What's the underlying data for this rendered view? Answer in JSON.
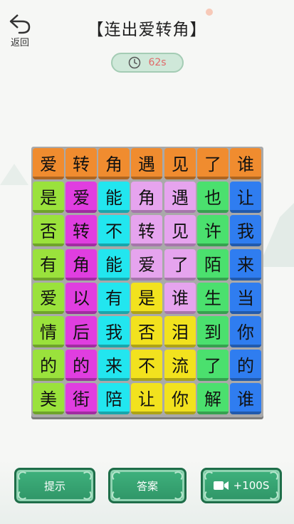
{
  "header": {
    "back_label": "返回",
    "title": "【连出爱转角】",
    "timer": "62s"
  },
  "colors": {
    "orange": "#f08c2f",
    "green": "#9ae23c",
    "magenta": "#e03ee0",
    "cyan": "#22e6ef",
    "lilac": "#e6a4ee",
    "blue": "#2f7df0",
    "yellow": "#f2e21e",
    "mint": "#4be06e"
  },
  "board": {
    "rows": [
      [
        {
          "ch": "爱",
          "c": "orange"
        },
        {
          "ch": "转",
          "c": "orange"
        },
        {
          "ch": "角",
          "c": "orange"
        },
        {
          "ch": "遇",
          "c": "orange"
        },
        {
          "ch": "见",
          "c": "orange"
        },
        {
          "ch": "了",
          "c": "orange"
        },
        {
          "ch": "谁",
          "c": "orange"
        }
      ],
      [
        {
          "ch": "是",
          "c": "green"
        },
        {
          "ch": "爱",
          "c": "magenta"
        },
        {
          "ch": "能",
          "c": "cyan"
        },
        {
          "ch": "角",
          "c": "lilac"
        },
        {
          "ch": "遇",
          "c": "lilac"
        },
        {
          "ch": "也",
          "c": "mint"
        },
        {
          "ch": "让",
          "c": "blue"
        }
      ],
      [
        {
          "ch": "否",
          "c": "green"
        },
        {
          "ch": "转",
          "c": "magenta"
        },
        {
          "ch": "不",
          "c": "cyan"
        },
        {
          "ch": "转",
          "c": "lilac"
        },
        {
          "ch": "见",
          "c": "lilac"
        },
        {
          "ch": "许",
          "c": "mint"
        },
        {
          "ch": "我",
          "c": "blue"
        }
      ],
      [
        {
          "ch": "有",
          "c": "green"
        },
        {
          "ch": "角",
          "c": "magenta"
        },
        {
          "ch": "能",
          "c": "cyan"
        },
        {
          "ch": "爱",
          "c": "lilac"
        },
        {
          "ch": "了",
          "c": "lilac"
        },
        {
          "ch": "陌",
          "c": "mint"
        },
        {
          "ch": "来",
          "c": "blue"
        }
      ],
      [
        {
          "ch": "爱",
          "c": "green"
        },
        {
          "ch": "以",
          "c": "magenta"
        },
        {
          "ch": "有",
          "c": "cyan"
        },
        {
          "ch": "是",
          "c": "yellow"
        },
        {
          "ch": "谁",
          "c": "lilac"
        },
        {
          "ch": "生",
          "c": "mint"
        },
        {
          "ch": "当",
          "c": "blue"
        }
      ],
      [
        {
          "ch": "情",
          "c": "green"
        },
        {
          "ch": "后",
          "c": "magenta"
        },
        {
          "ch": "我",
          "c": "cyan"
        },
        {
          "ch": "否",
          "c": "yellow"
        },
        {
          "ch": "泪",
          "c": "yellow"
        },
        {
          "ch": "到",
          "c": "mint"
        },
        {
          "ch": "你",
          "c": "blue"
        }
      ],
      [
        {
          "ch": "的",
          "c": "green"
        },
        {
          "ch": "的",
          "c": "magenta"
        },
        {
          "ch": "来",
          "c": "cyan"
        },
        {
          "ch": "不",
          "c": "yellow"
        },
        {
          "ch": "流",
          "c": "yellow"
        },
        {
          "ch": "了",
          "c": "mint"
        },
        {
          "ch": "的",
          "c": "blue"
        }
      ],
      [
        {
          "ch": "美",
          "c": "green"
        },
        {
          "ch": "街",
          "c": "magenta"
        },
        {
          "ch": "陪",
          "c": "cyan"
        },
        {
          "ch": "让",
          "c": "yellow"
        },
        {
          "ch": "你",
          "c": "yellow"
        },
        {
          "ch": "解",
          "c": "mint"
        },
        {
          "ch": "谁",
          "c": "blue"
        }
      ]
    ]
  },
  "buttons": {
    "hint": "提示",
    "answer": "答案",
    "video": "+100S"
  },
  "icons": {
    "back": "back-arrow-icon",
    "timer": "clock-icon",
    "video": "video-camera-icon"
  }
}
